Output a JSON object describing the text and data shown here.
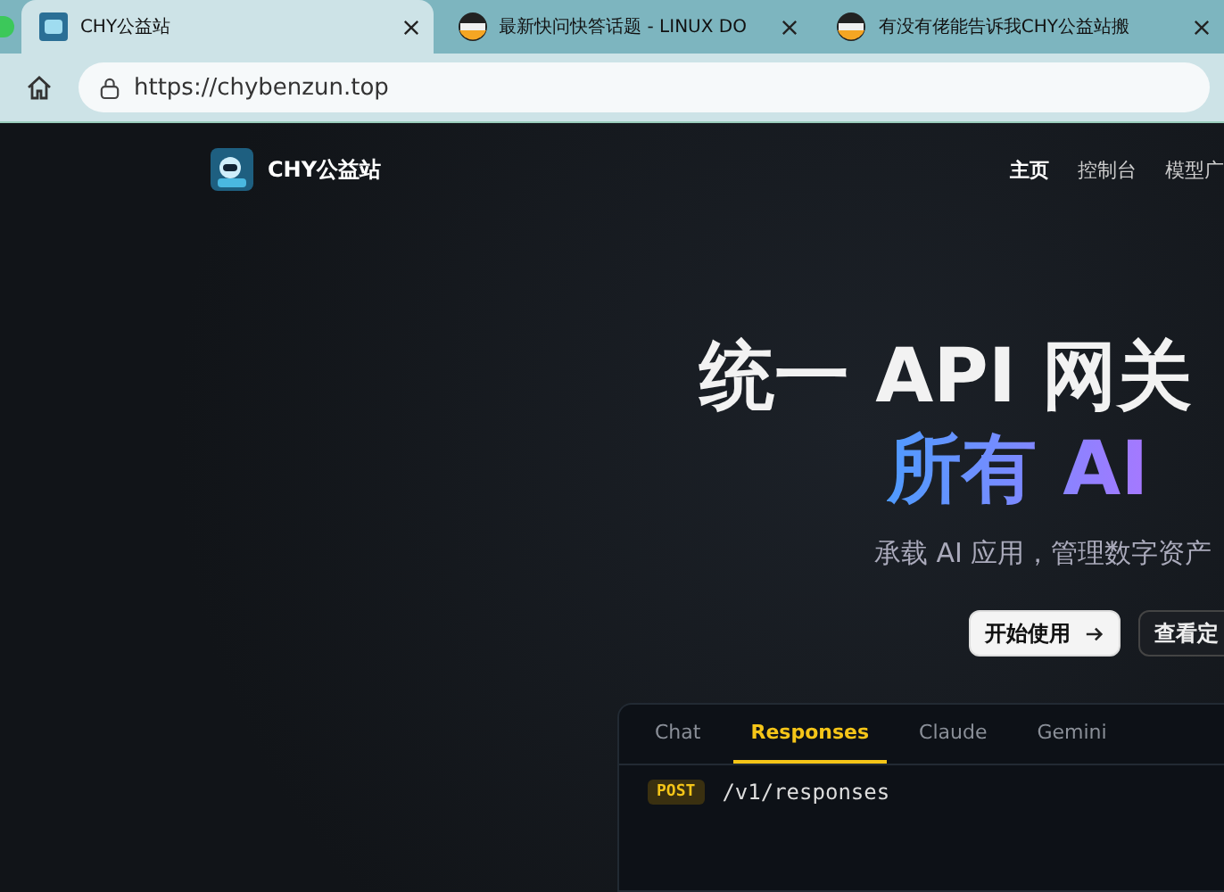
{
  "browser": {
    "tabs": [
      {
        "title": "CHY公益站",
        "selected": true
      },
      {
        "title": "最新快问快答话题 - LINUX DO",
        "selected": false
      },
      {
        "title": "有没有佬能告诉我CHY公益站搬",
        "selected": false
      }
    ],
    "address": "https://chybenzun.top"
  },
  "site": {
    "name": "CHY公益站",
    "nav": [
      {
        "label": "主页",
        "selected": true
      },
      {
        "label": "控制台",
        "selected": false
      },
      {
        "label": "模型广",
        "selected": false
      }
    ]
  },
  "hero": {
    "headline": "统一 API 网关",
    "headline_accent": "所有 AI",
    "subtitle": "承载 AI 应用，管理数字资产",
    "buttons": [
      {
        "label": "开始使用",
        "kind": "primary"
      },
      {
        "label": "查看定",
        "kind": "secondary"
      }
    ]
  },
  "code_panel": {
    "tabs": [
      {
        "label": "Chat",
        "selected": false
      },
      {
        "label": "Responses",
        "selected": true
      },
      {
        "label": "Claude",
        "selected": false
      },
      {
        "label": "Gemini",
        "selected": false
      }
    ],
    "method": "POST",
    "path": "/v1/responses"
  }
}
